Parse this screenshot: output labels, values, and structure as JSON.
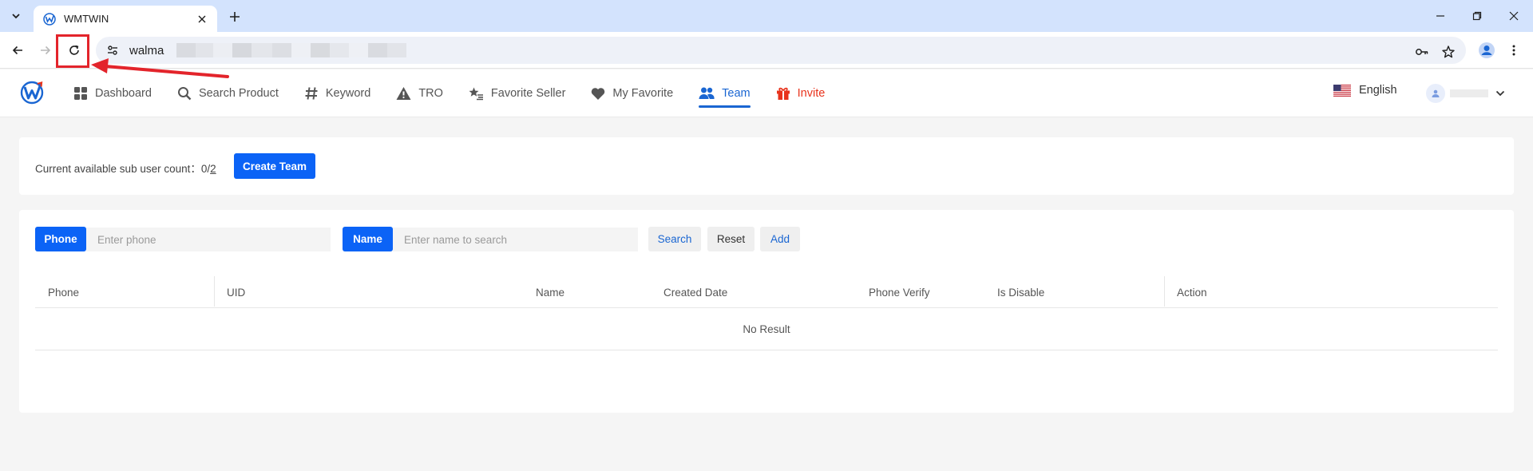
{
  "browser": {
    "tab_title": "WMTWIN",
    "url": "walma",
    "colors": {
      "tabstrip": "#d3e3fd",
      "highlight": "#e3242b"
    }
  },
  "header": {
    "nav": [
      {
        "label": "Dashboard",
        "icon": "dashboard-grid-icon"
      },
      {
        "label": "Search Product",
        "icon": "search-icon"
      },
      {
        "label": "Keyword",
        "icon": "hash-icon"
      },
      {
        "label": "TRO",
        "icon": "warning-icon"
      },
      {
        "label": "Favorite Seller",
        "icon": "star-list-icon"
      },
      {
        "label": "My Favorite",
        "icon": "heart-icon"
      },
      {
        "label": "Team",
        "icon": "team-icon",
        "active": true
      },
      {
        "label": "Invite",
        "icon": "gift-icon"
      }
    ],
    "language": "English",
    "colors": {
      "active": "#1a66d2",
      "invite": "#e8331c",
      "primary": "#0b63f6"
    }
  },
  "team_summary": {
    "label": "Current available sub user count：",
    "used": "0/",
    "total": "2",
    "create_button": "Create Team"
  },
  "filters": {
    "phone_label": "Phone",
    "phone_placeholder": "Enter phone",
    "name_label": "Name",
    "name_placeholder": "Enter name to search",
    "search_button": "Search",
    "reset_button": "Reset",
    "add_button": "Add"
  },
  "table": {
    "columns": [
      "Phone",
      "UID",
      "Name",
      "Created Date",
      "Phone Verify",
      "Is Disable",
      "Action"
    ],
    "empty_text": "No Result"
  }
}
